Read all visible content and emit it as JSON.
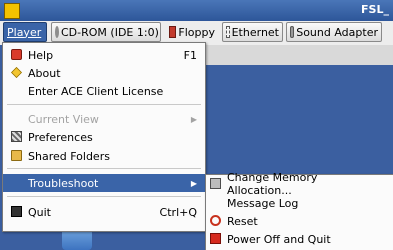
{
  "window": {
    "title": "FSL_"
  },
  "toolbar": {
    "player": "Player",
    "cdrom": "CD-ROM (IDE 1:0)",
    "floppy": "Floppy",
    "ethernet": "Ethernet",
    "sound": "Sound Adapter"
  },
  "player_menu": {
    "help": "Help",
    "help_shortcut": "F1",
    "about": "About",
    "license": "Enter ACE Client License",
    "current_view": "Current View",
    "preferences": "Preferences",
    "shared_folders": "Shared Folders",
    "troubleshoot": "Troubleshoot",
    "quit": "Quit",
    "quit_shortcut": "Ctrl+Q"
  },
  "troubleshoot_menu": {
    "change_memory": "Change Memory Allocation...",
    "message_log": "Message Log",
    "reset": "Reset",
    "power_off": "Power Off and Quit"
  },
  "icons": {
    "help": "help-icon",
    "about": "about-star-icon",
    "preferences": "preferences-icon",
    "shared_folders": "folder-icon",
    "quit": "quit-icon",
    "change_memory": "memory-search-icon",
    "reset": "reset-icon",
    "power_off": "power-off-icon"
  },
  "colors": {
    "highlight": "#3a64a8",
    "titlebar": "#2d5699",
    "desktop": "#3b5fa0"
  }
}
